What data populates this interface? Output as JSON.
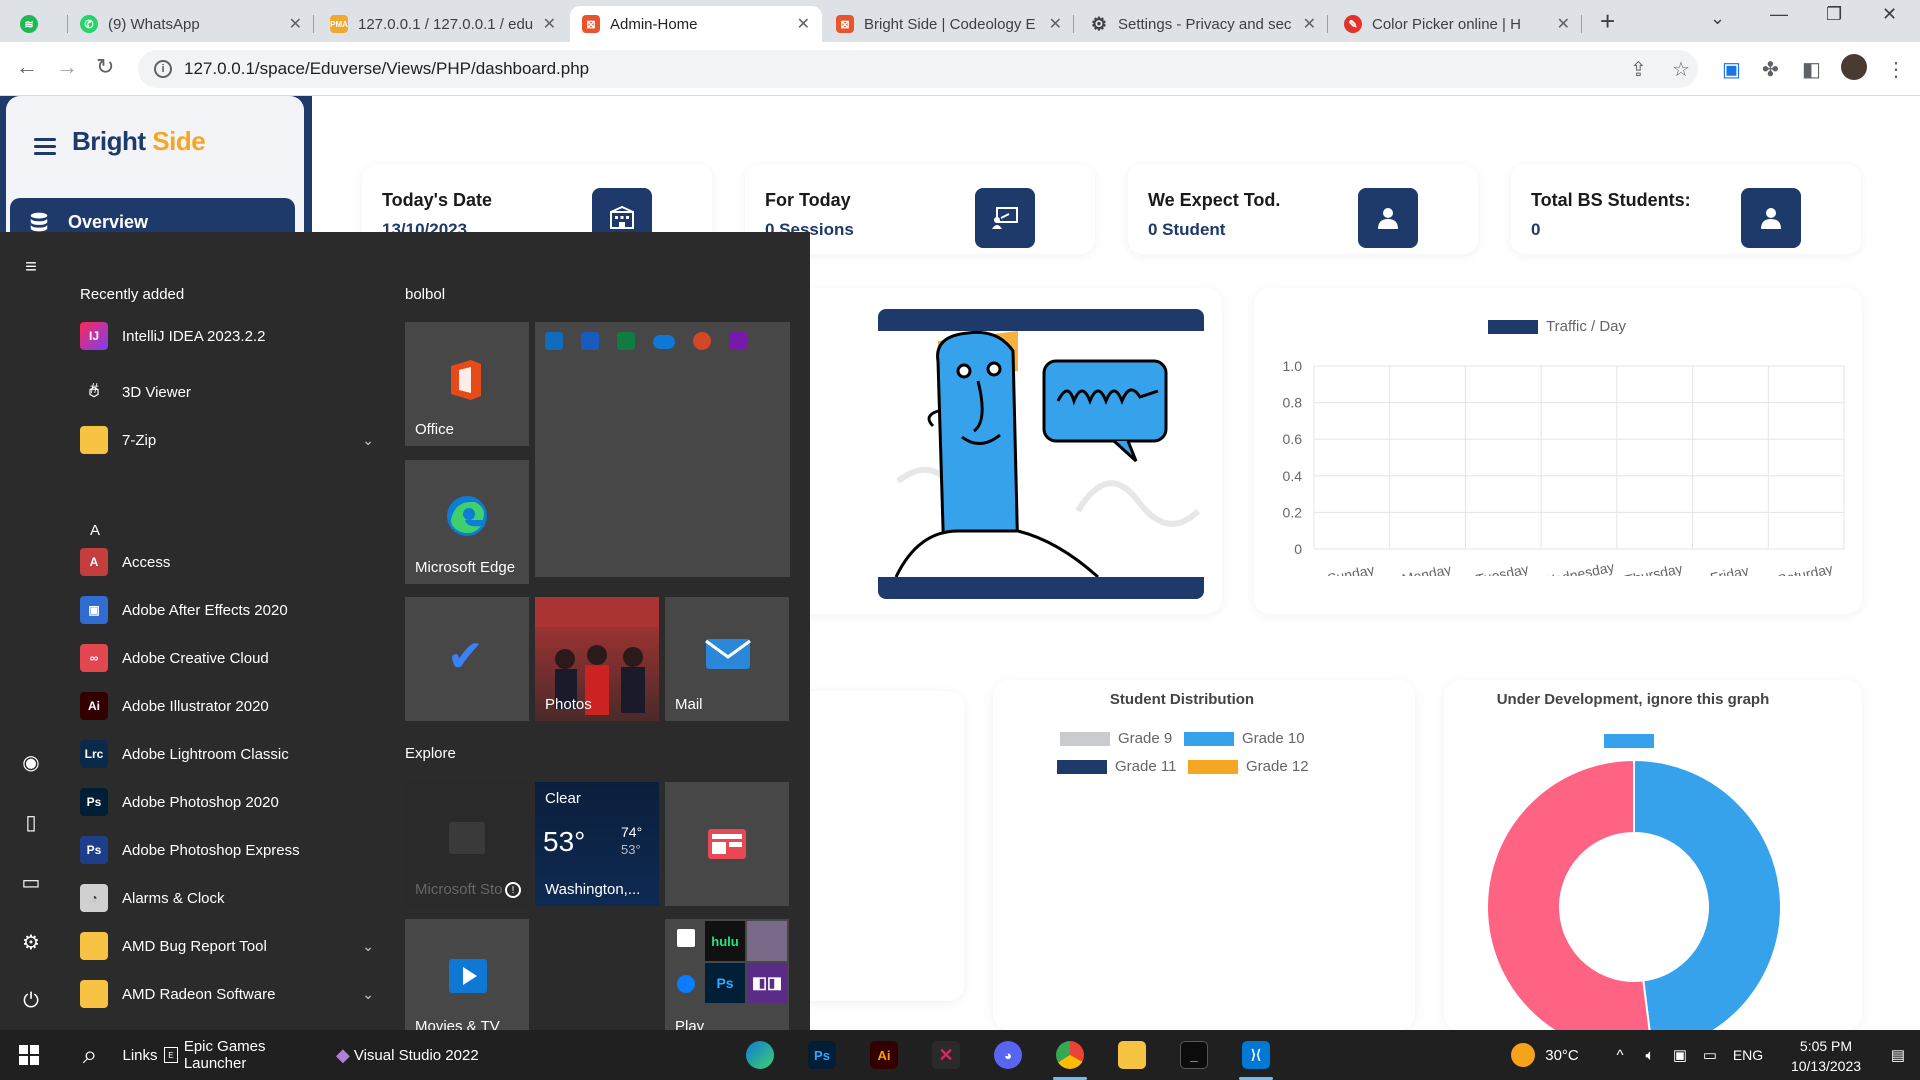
{
  "browser": {
    "tabs": [
      {
        "title": "",
        "favicon_color": "#1db954",
        "kind": "spotify"
      },
      {
        "title": "(9) WhatsApp",
        "favicon_color": "#25d366"
      },
      {
        "title": "127.0.0.1 / 127.0.0.1 / edu",
        "favicon_color": "#f0a830"
      },
      {
        "title": "Admin-Home",
        "favicon_color": "#e8542c",
        "active": true
      },
      {
        "title": "Bright Side | Codeology E",
        "favicon_color": "#e8542c"
      },
      {
        "title": "Settings - Privacy and sec",
        "favicon_color": "#5f6368"
      },
      {
        "title": "Color Picker online | H",
        "favicon_color": "#e4322b"
      }
    ],
    "url": "127.0.0.1/space/Eduverse/Views/PHP/dashboard.php"
  },
  "sidebar": {
    "brand_bright": "Bright",
    "brand_side": "Side",
    "overview_label": "Overview"
  },
  "stats": [
    {
      "label": "Today's Date",
      "value": "13/10/2023",
      "icon": "building-icon"
    },
    {
      "label": "For Today",
      "value": "0 Sessions",
      "icon": "presentation-icon"
    },
    {
      "label": "We Expect Tod.",
      "value": "0 Student",
      "icon": "user-icon"
    },
    {
      "label": "Total BS Students:",
      "value": "0",
      "icon": "user-icon"
    }
  ],
  "traffic_chart": {
    "chart_data": {
      "type": "bar",
      "title": "",
      "legend": "Traffic / Day",
      "categories": [
        "Sunday",
        "Monday",
        "Tuesday",
        "Wednesday",
        "Thursday",
        "Friday",
        "Saturday"
      ],
      "series": [
        {
          "name": "Traffic / Day",
          "values": [
            0,
            0,
            0,
            0,
            0,
            0,
            0
          ]
        }
      ],
      "yticks": [
        "1.0",
        "0.8",
        "0.6",
        "0.4",
        "0.2",
        "0"
      ],
      "ylim": [
        0,
        1
      ],
      "color": "#1e3a6b"
    }
  },
  "student_distribution": {
    "title": "Student Distribution",
    "legend": [
      {
        "name": "Grade 9",
        "color": "#c9cbcf"
      },
      {
        "name": "Grade 10",
        "color": "#36a2eb"
      },
      {
        "name": "Grade 11",
        "color": "#1e3a6b"
      },
      {
        "name": "Grade 12",
        "color": "#f5a623"
      }
    ]
  },
  "dev_chart": {
    "title": "Under Development, ignore this graph",
    "chart_data": {
      "type": "pie",
      "slices": [
        {
          "name": "",
          "value": 48,
          "color": "#36a2eb"
        },
        {
          "name": "",
          "value": 52,
          "color": "#ff6384"
        }
      ]
    }
  },
  "start_menu": {
    "recently_added": "Recently added",
    "recent_app": "IntelliJ IDEA 2023.2.2",
    "letter_hash": "#",
    "letter_a": "A",
    "apps": [
      {
        "name": "3D Viewer",
        "color": "transparent",
        "glyph": "⬡"
      },
      {
        "name": "7-Zip",
        "color": "#f6c343",
        "glyph": "",
        "expand": true
      },
      {
        "name": "Access",
        "color": "#c43e3e",
        "glyph": "A"
      },
      {
        "name": "Adobe After Effects 2020",
        "color": "#2f6dd1",
        "glyph": "▣"
      },
      {
        "name": "Adobe Creative Cloud",
        "color": "#e34850",
        "glyph": "∞"
      },
      {
        "name": "Adobe Illustrator 2020",
        "color": "#330000",
        "glyph": "Ai"
      },
      {
        "name": "Adobe Lightroom Classic",
        "color": "#0a2a4a",
        "glyph": "Lrc"
      },
      {
        "name": "Adobe Photoshop 2020",
        "color": "#001e36",
        "glyph": "Ps"
      },
      {
        "name": "Adobe Photoshop Express",
        "color": "#1f3e8a",
        "glyph": "Ps"
      },
      {
        "name": "Alarms & Clock",
        "color": "#d0d0d0",
        "glyph": "◔"
      },
      {
        "name": "AMD Bug Report Tool",
        "color": "#f6c343",
        "glyph": "",
        "expand": true
      },
      {
        "name": "AMD Radeon Software",
        "color": "#f6c343",
        "glyph": "",
        "expand": true
      }
    ],
    "group_bolbol": "bolbol",
    "group_explore": "Explore",
    "tiles": {
      "office": "Office",
      "edge": "Microsoft Edge",
      "photos": "Photos",
      "mail": "Mail",
      "store": "Microsoft Sto",
      "weather_cond": "Clear",
      "weather_temp": "53°",
      "weather_hi": "74°",
      "weather_lo": "53°",
      "weather_loc": "Washington,...",
      "movies": "Movies & TV",
      "play": "Play"
    }
  },
  "taskbar": {
    "links": "Links",
    "epic": "Epic Games Launcher",
    "vs": "Visual Studio 2022",
    "temp": "30°C",
    "lang": "ENG",
    "time": "5:05 PM",
    "date": "10/13/2023"
  }
}
